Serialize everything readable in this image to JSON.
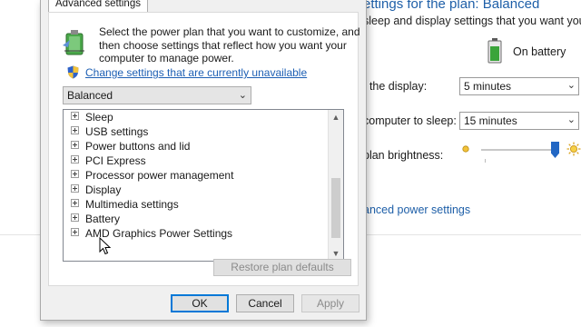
{
  "background_window": {
    "heading": "ettings for the plan: Balanced",
    "description": "sleep and display settings that you want your",
    "on_battery_label": "On battery",
    "turn_off_display_label": "f the display:",
    "turn_off_display_value": "5 minutes",
    "sleep_label": "computer to sleep:",
    "sleep_value": "15 minutes",
    "brightness_label": "plan brightness:",
    "brightness_level_percent": 95,
    "advanced_link": "anced power settings"
  },
  "dialog": {
    "tab_label": "Advanced settings",
    "intro_lines": [
      "Select the power plan that you want to customize, and",
      "then choose settings that reflect how you want your",
      "computer to manage power."
    ],
    "change_link": "Change settings that are currently unavailable",
    "plan_select": "Balanced",
    "tree_items": [
      "Sleep",
      "USB settings",
      "Power buttons and lid",
      "PCI Express",
      "Processor power management",
      "Display",
      "Multimedia settings",
      "Battery",
      "AMD Graphics Power Settings"
    ],
    "restore_button": "Restore plan defaults",
    "ok_button": "OK",
    "cancel_button": "Cancel",
    "apply_button": "Apply"
  },
  "colors": {
    "link": "#1d5fb4",
    "heading": "#1e5fa8",
    "slider_thumb": "#2267c4",
    "battery_green": "#3aa43a",
    "default_button_border": "#0078d7"
  },
  "icons": [
    "battery-icon",
    "power-options-icon",
    "uac-shield-icon",
    "brightness-low-icon",
    "brightness-high-icon",
    "mouse-cursor-icon",
    "chevron-down-icon",
    "scroll-up-icon",
    "scroll-down-icon",
    "expand-plus-icon"
  ]
}
